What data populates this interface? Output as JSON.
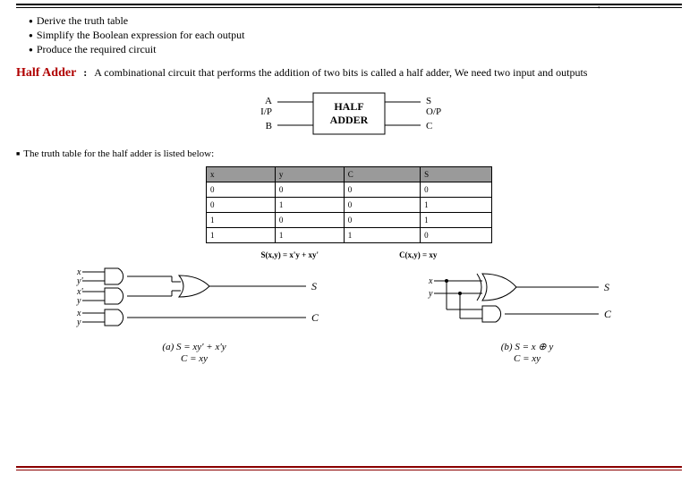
{
  "page_marker": "'",
  "bullets": [
    "Derive the truth table",
    "Simplify the Boolean expression for each output",
    "Produce the required circuit"
  ],
  "half_adder": {
    "title": "Half Adder",
    "colon": ":",
    "desc": "A combinational circuit that performs the addition of two bits is called a half adder, We need two input and outputs"
  },
  "block": {
    "in1": "A",
    "in1_sub": "I/P",
    "in2": "B",
    "label_top": "HALF",
    "label_bot": "ADDER",
    "out1": "S",
    "out1_sub": "O/P",
    "out2": "C"
  },
  "truth_intro": "The truth table for the half adder is listed below:",
  "truth": {
    "headers": [
      "x",
      "y",
      "C",
      "S"
    ],
    "rows": [
      [
        "0",
        "0",
        "0",
        "0"
      ],
      [
        "0",
        "1",
        "0",
        "1"
      ],
      [
        "1",
        "0",
        "0",
        "1"
      ],
      [
        "1",
        "1",
        "1",
        "0"
      ]
    ]
  },
  "equations": {
    "sum": "S(x,y) = x'y + xy'",
    "carry": "C(x,y) = xy"
  },
  "circuit_labels": {
    "x": "x",
    "y": "y",
    "xp": "x'",
    "yp": "y'",
    "S": "S",
    "C": "C",
    "cap_a_line1": "(a) S = xy' + x'y",
    "cap_a_line2": "C = xy",
    "cap_b_line1": "(b) S = x ⊕ y",
    "cap_b_line2": "C = xy"
  },
  "footer": {
    "left": "",
    "right": ""
  }
}
